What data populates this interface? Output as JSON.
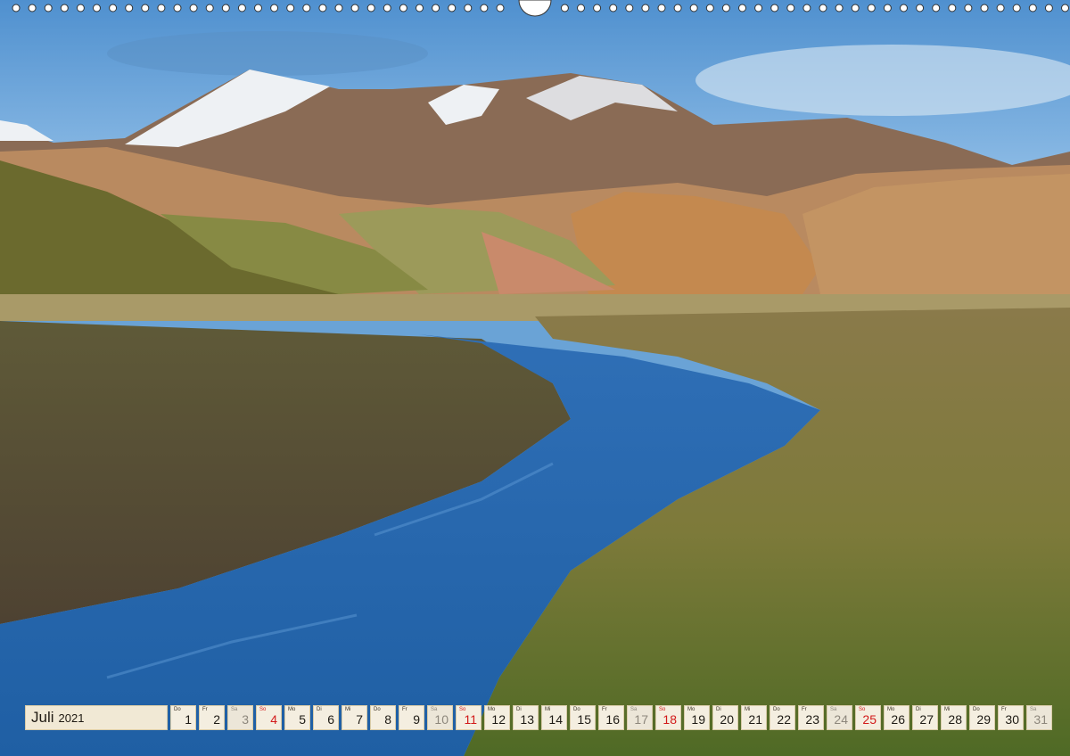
{
  "calendar": {
    "month": "Juli",
    "year": "2021",
    "days": [
      {
        "wd": "Do",
        "num": "1",
        "type": "weekday"
      },
      {
        "wd": "Fr",
        "num": "2",
        "type": "weekday"
      },
      {
        "wd": "Sa",
        "num": "3",
        "type": "sat"
      },
      {
        "wd": "So",
        "num": "4",
        "type": "sun"
      },
      {
        "wd": "Mo",
        "num": "5",
        "type": "weekday"
      },
      {
        "wd": "Di",
        "num": "6",
        "type": "weekday"
      },
      {
        "wd": "Mi",
        "num": "7",
        "type": "weekday"
      },
      {
        "wd": "Do",
        "num": "8",
        "type": "weekday"
      },
      {
        "wd": "Fr",
        "num": "9",
        "type": "weekday"
      },
      {
        "wd": "Sa",
        "num": "10",
        "type": "sat"
      },
      {
        "wd": "So",
        "num": "11",
        "type": "sun"
      },
      {
        "wd": "Mo",
        "num": "12",
        "type": "weekday"
      },
      {
        "wd": "Di",
        "num": "13",
        "type": "weekday"
      },
      {
        "wd": "Mi",
        "num": "14",
        "type": "weekday"
      },
      {
        "wd": "Do",
        "num": "15",
        "type": "weekday"
      },
      {
        "wd": "Fr",
        "num": "16",
        "type": "weekday"
      },
      {
        "wd": "Sa",
        "num": "17",
        "type": "sat"
      },
      {
        "wd": "So",
        "num": "18",
        "type": "sun"
      },
      {
        "wd": "Mo",
        "num": "19",
        "type": "weekday"
      },
      {
        "wd": "Di",
        "num": "20",
        "type": "weekday"
      },
      {
        "wd": "Mi",
        "num": "21",
        "type": "weekday"
      },
      {
        "wd": "Do",
        "num": "22",
        "type": "weekday"
      },
      {
        "wd": "Fr",
        "num": "23",
        "type": "weekday"
      },
      {
        "wd": "Sa",
        "num": "24",
        "type": "sat"
      },
      {
        "wd": "So",
        "num": "25",
        "type": "sun"
      },
      {
        "wd": "Mo",
        "num": "26",
        "type": "weekday"
      },
      {
        "wd": "Di",
        "num": "27",
        "type": "weekday"
      },
      {
        "wd": "Mi",
        "num": "28",
        "type": "weekday"
      },
      {
        "wd": "Do",
        "num": "29",
        "type": "weekday"
      },
      {
        "wd": "Fr",
        "num": "30",
        "type": "weekday"
      },
      {
        "wd": "Sa",
        "num": "31",
        "type": "sat"
      }
    ]
  },
  "colors": {
    "sky": "#6aa3d6",
    "sunday_red": "#d21a1a",
    "saturday_grey": "#8d877c",
    "cell_bg": "#f4eee0"
  }
}
